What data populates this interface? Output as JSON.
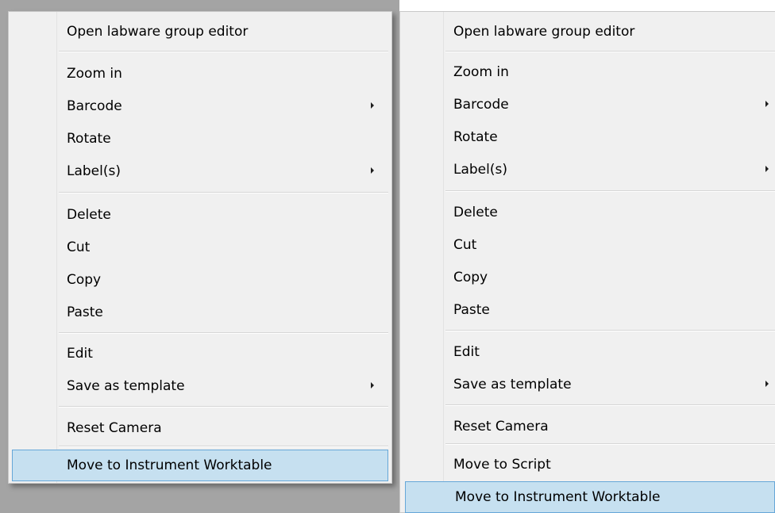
{
  "menus": {
    "left": {
      "items": [
        {
          "label": "Open labware group editor"
        },
        {
          "label": "Zoom in"
        },
        {
          "label": "Barcode",
          "submenu": true
        },
        {
          "label": "Rotate"
        },
        {
          "label": "Label(s)",
          "submenu": true
        },
        {
          "label": "Delete"
        },
        {
          "label": "Cut"
        },
        {
          "label": "Copy"
        },
        {
          "label": "Paste"
        },
        {
          "label": "Edit"
        },
        {
          "label": "Save as template",
          "submenu": true
        },
        {
          "label": "Reset Camera"
        },
        {
          "label": "Move to Instrument Worktable",
          "highlighted": true
        }
      ]
    },
    "right": {
      "items": [
        {
          "label": "Open labware group editor"
        },
        {
          "label": "Zoom in"
        },
        {
          "label": "Barcode",
          "submenu": true
        },
        {
          "label": "Rotate"
        },
        {
          "label": "Label(s)",
          "submenu": true
        },
        {
          "label": "Delete"
        },
        {
          "label": "Cut"
        },
        {
          "label": "Copy"
        },
        {
          "label": "Paste"
        },
        {
          "label": "Edit"
        },
        {
          "label": "Save as template",
          "submenu": true
        },
        {
          "label": "Reset Camera"
        },
        {
          "label": "Move to Script"
        },
        {
          "label": "Move to Instrument Worktable",
          "highlighted": true
        }
      ]
    }
  },
  "colors": {
    "menu_background": "#f0f0f0",
    "highlight_fill": "#c6e0f0",
    "highlight_border": "#66a7d8",
    "backdrop": "#a4a4a4"
  },
  "icons": {
    "submenu": "submenu-arrow-icon"
  }
}
